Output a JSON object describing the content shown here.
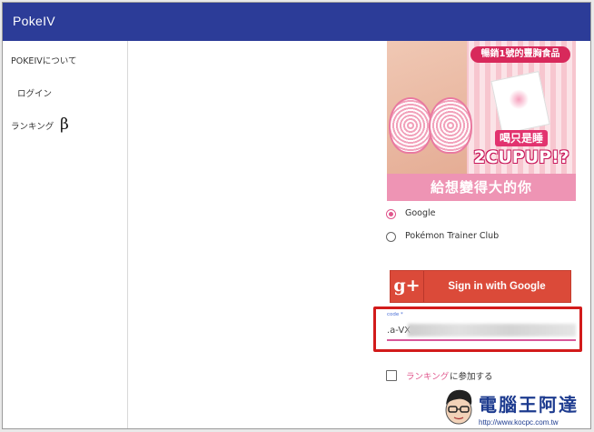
{
  "app": {
    "title": "PokeIV"
  },
  "sidebar": {
    "items": [
      {
        "label": "POKEIVについて"
      },
      {
        "label": "ログイン"
      },
      {
        "label": "ランキング"
      }
    ],
    "beta_symbol": "β"
  },
  "ad": {
    "top_banner": "暢銷1號的豐胸食品",
    "headline_1": "喝只是睡",
    "headline_2": "2CUPUP!?",
    "bottom_text": "給想變得大的你"
  },
  "login": {
    "options": [
      {
        "label": "Google",
        "selected": true
      },
      {
        "label": "Pokémon Trainer Club",
        "selected": false
      }
    ],
    "google_button": {
      "icon_text": "g+",
      "label": "Sign in with Google"
    },
    "code_field": {
      "label": "code *",
      "value": ".a-VX"
    },
    "ranking_checkbox": {
      "link_text": "ランキング",
      "rest_text": "に参加する",
      "checked": false
    }
  },
  "watermark": {
    "title": "電腦王阿達",
    "url": "http://www.kocpc.com.tw"
  },
  "colors": {
    "appbar": "#2c3c98",
    "accent_pink": "#e0578d",
    "google_red": "#db4a39",
    "highlight_red": "#d21b1b"
  }
}
